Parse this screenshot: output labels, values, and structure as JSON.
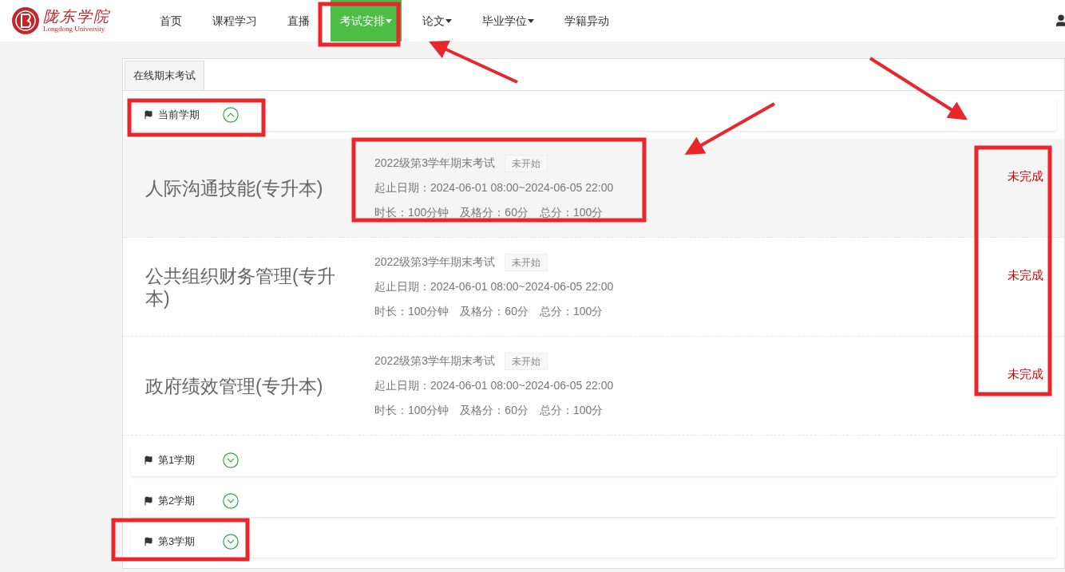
{
  "logo": {
    "name": "陇东学院",
    "subtitle": "Longdong University"
  },
  "nav": [
    {
      "label": "首页",
      "selected": false,
      "dropdown": false
    },
    {
      "label": "课程学习",
      "selected": false,
      "dropdown": false
    },
    {
      "label": "直播",
      "selected": false,
      "dropdown": false
    },
    {
      "label": "考试安排",
      "selected": true,
      "dropdown": true
    },
    {
      "label": "论文",
      "selected": false,
      "dropdown": true
    },
    {
      "label": "毕业学位",
      "selected": false,
      "dropdown": true
    },
    {
      "label": "学籍异动",
      "selected": false,
      "dropdown": false
    }
  ],
  "tabs": [
    {
      "label": "在线期末考试",
      "selected": true
    }
  ],
  "semesters": [
    {
      "label": "当前学期",
      "expanded": true,
      "exams": [
        {
          "course": "人际沟通技能(专升本)",
          "title": "2022级第3学年期末考试",
          "badge": "未开始",
          "dates": "起止日期：2024-06-01 08:00~2024-06-05 22:00",
          "duration": "时长：100分钟",
          "pass": "及格分：60分",
          "total": "总分：100分",
          "status": "未完成",
          "highlighted": true
        },
        {
          "course": "公共组织财务管理(专升本)",
          "title": "2022级第3学年期末考试",
          "badge": "未开始",
          "dates": "起止日期：2024-06-01 08:00~2024-06-05 22:00",
          "duration": "时长：100分钟",
          "pass": "及格分：60分",
          "total": "总分：100分",
          "status": "未完成",
          "highlighted": false
        },
        {
          "course": "政府绩效管理(专升本)",
          "title": "2022级第3学年期末考试",
          "badge": "未开始",
          "dates": "起止日期：2024-06-01 08:00~2024-06-05 22:00",
          "duration": "时长：100分钟",
          "pass": "及格分：60分",
          "total": "总分：100分",
          "status": "未完成",
          "highlighted": false
        }
      ]
    },
    {
      "label": "第1学期",
      "expanded": false
    },
    {
      "label": "第2学期",
      "expanded": false
    },
    {
      "label": "第3学期",
      "expanded": false
    }
  ]
}
